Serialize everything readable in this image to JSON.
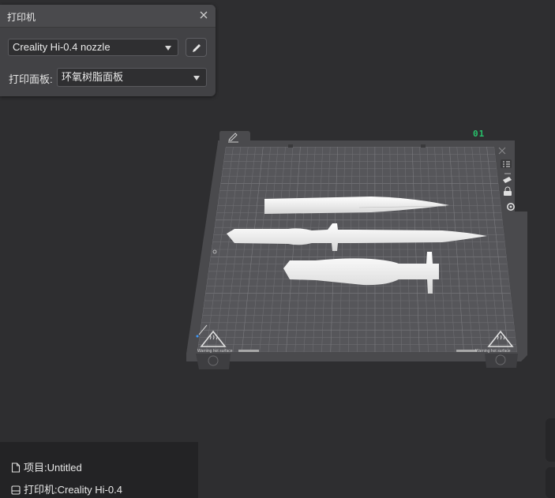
{
  "printer_panel": {
    "title": "打印机",
    "nozzle_selected": "Creality Hi-0.4 nozzle",
    "plate_label": "打印面板:",
    "plate_selected": "环氧树脂面板"
  },
  "plate": {
    "number": "01",
    "warning_text": "Warning hot surface"
  },
  "project_info": {
    "project": "项目:Untitled",
    "printer": "打印机:Creality Hi-0.4"
  },
  "icons": [
    "close-icon",
    "chevron-down-icon",
    "pencil-icon",
    "plate-edit-icon",
    "list-icon",
    "arrange-icon",
    "lock-icon",
    "gear-icon",
    "file-icon",
    "printer-icon",
    "warning-hot-surface-icon"
  ],
  "colors": {
    "accent_green": "#27c26b",
    "background": "#2e2e30"
  }
}
